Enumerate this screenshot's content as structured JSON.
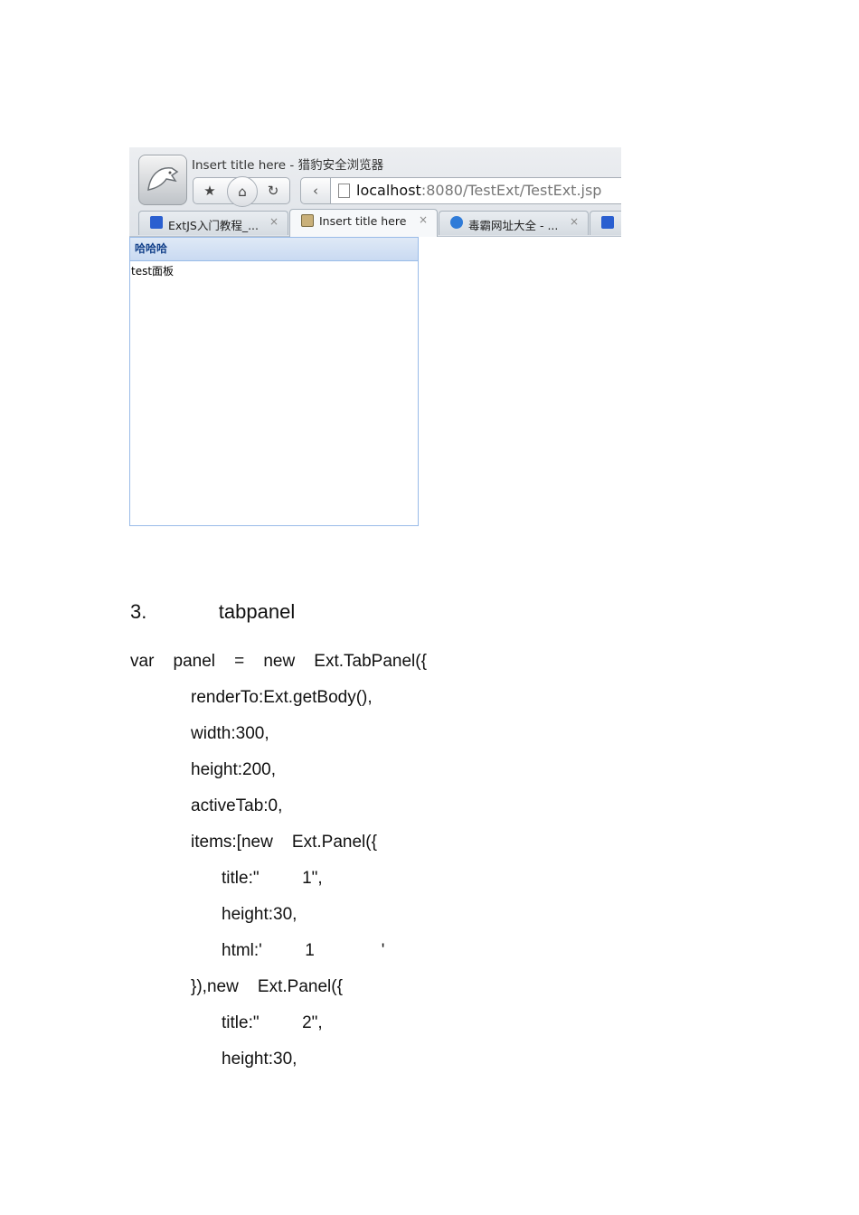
{
  "browser": {
    "window_title": "Insert title here - 猎豹安全浏览器",
    "nav_icons": [
      "star-icon",
      "home-icon",
      "reload-icon",
      "back-icon"
    ],
    "address": {
      "host": "localhost",
      "rest": ":8080/TestExt/TestExt.jsp"
    },
    "tabs": [
      {
        "label": "ExtJS入门教程_...",
        "close": "×",
        "icon": "paw-icon"
      },
      {
        "label": "Insert title here",
        "close": "×",
        "icon": "page-image-icon",
        "active": true
      },
      {
        "label": "毒霸网址大全 - ...",
        "close": "×",
        "icon": "k-icon"
      }
    ],
    "ext_panel": {
      "title": "哈哈哈",
      "body": "test面板"
    }
  },
  "doc": {
    "heading": "3.             tabpanel",
    "code_lines": [
      "var    panel    =    new    Ext.TabPanel({",
      "renderTo:Ext.getBody(),",
      "width:300,",
      "height:200,",
      "activeTab:0,",
      "items:[new    Ext.Panel({",
      "title:\"         1\",",
      "height:30,",
      "html:'         1              '",
      "}),new    Ext.Panel({",
      "title:\"         2\",",
      "height:30,"
    ]
  }
}
